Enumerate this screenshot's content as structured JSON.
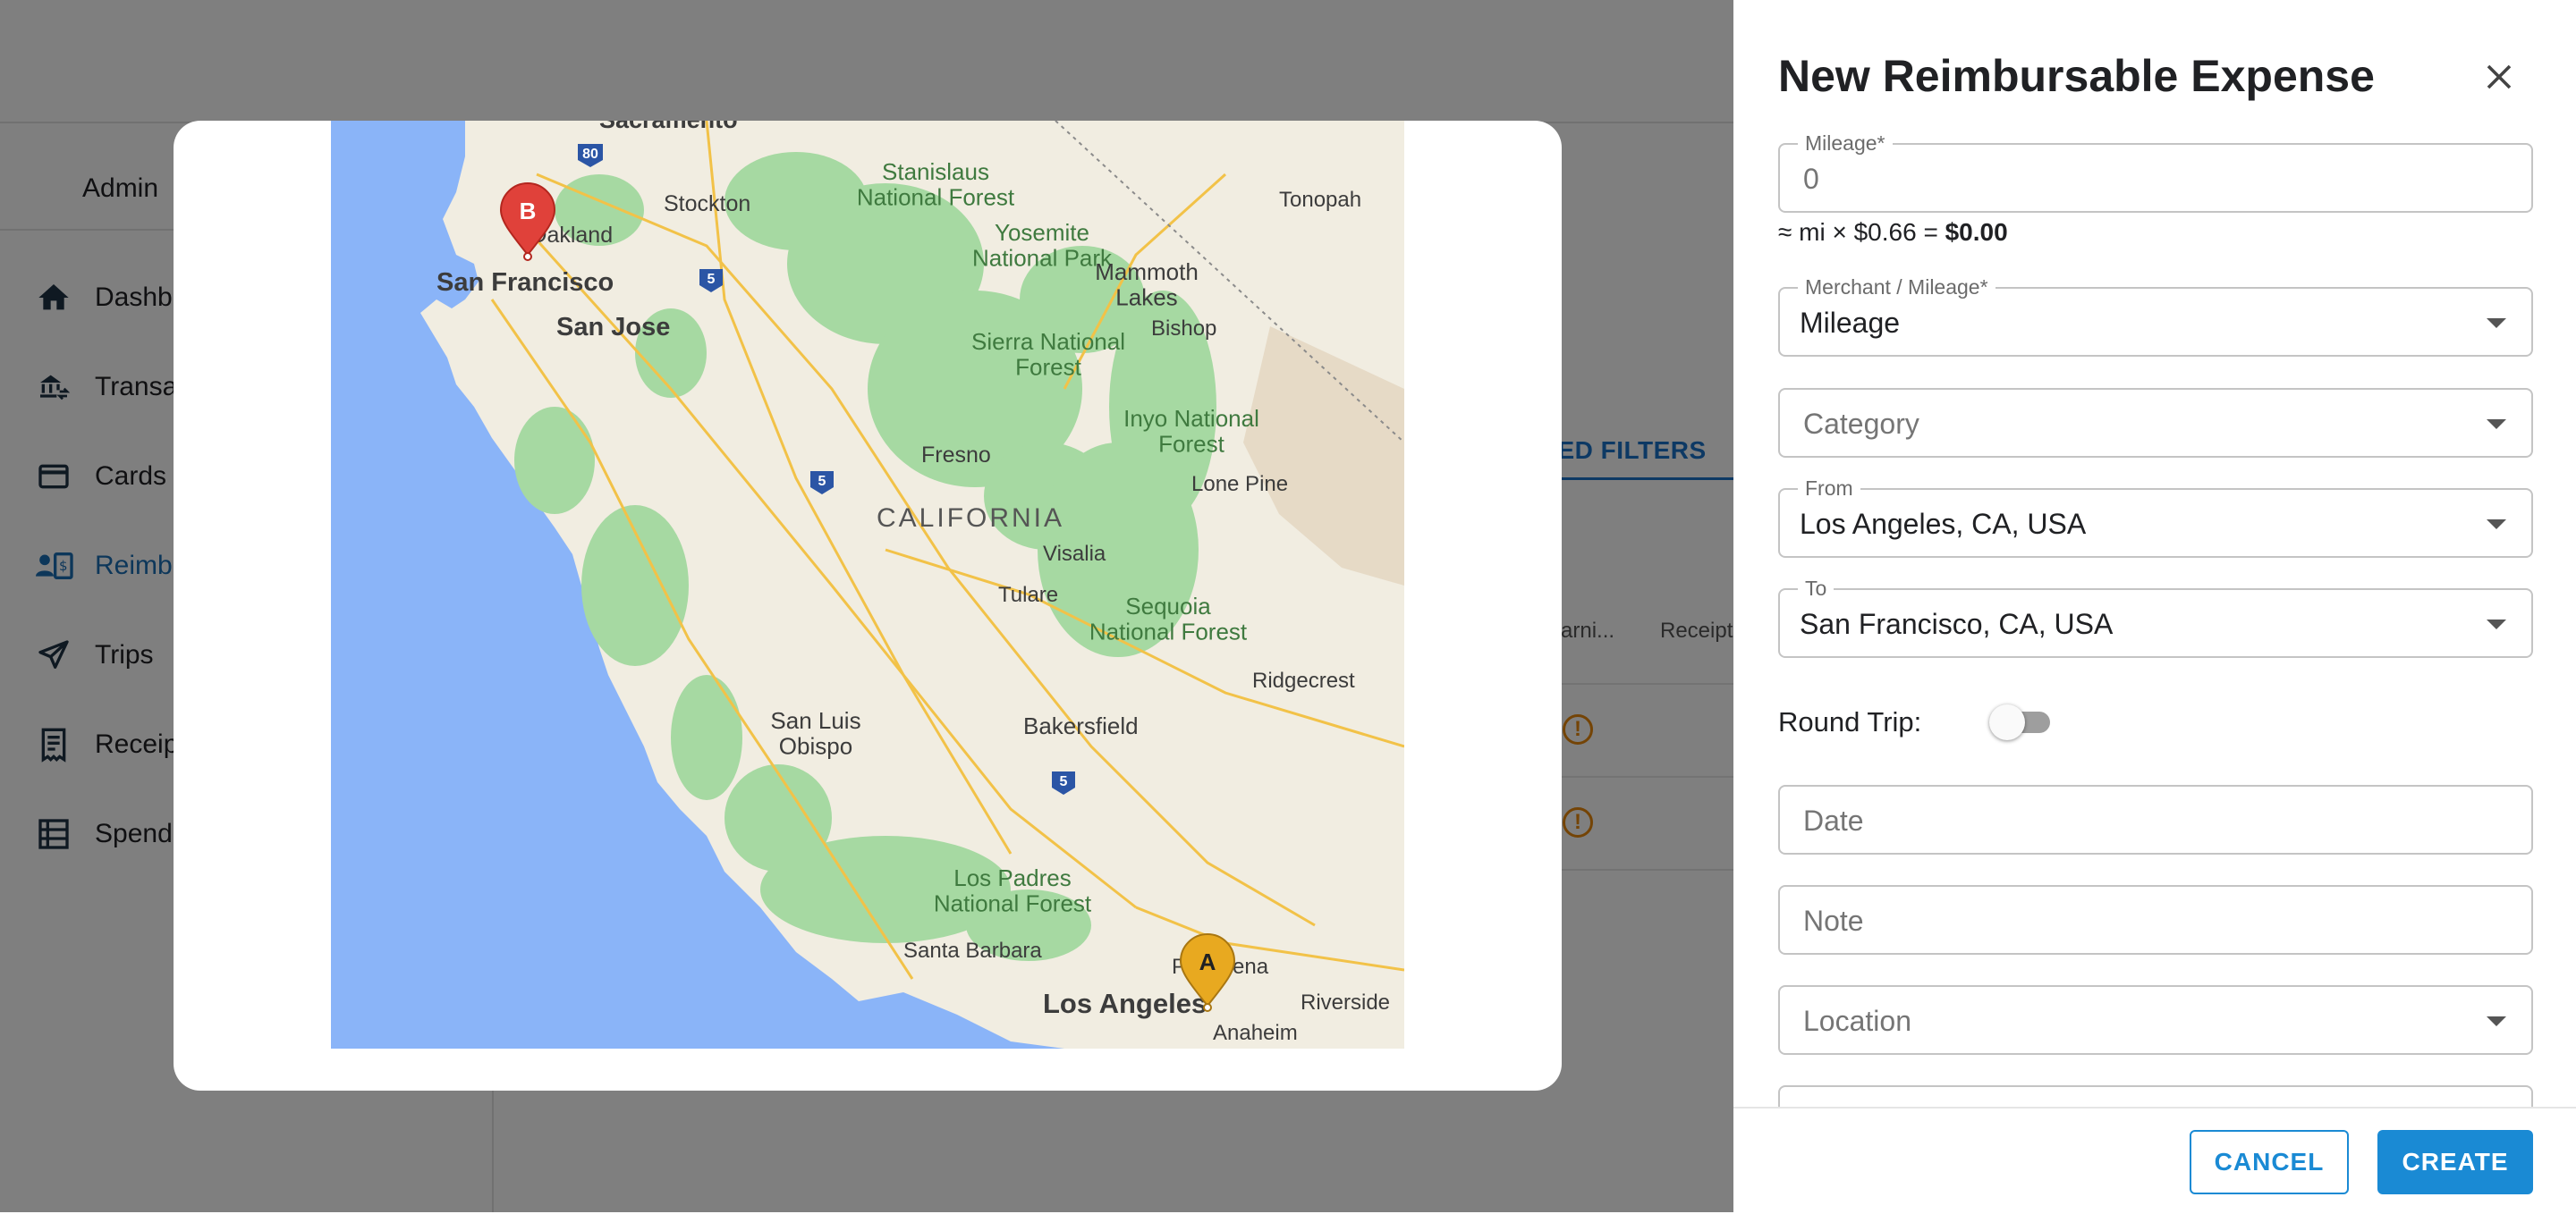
{
  "app": {
    "subnav_title": "Admin",
    "sidebar": {
      "items": [
        {
          "label": "Dashb",
          "icon": "home-icon"
        },
        {
          "label": "Transa",
          "icon": "bank-transfer-icon"
        },
        {
          "label": "Cards",
          "icon": "card-icon"
        },
        {
          "label": "Reimb",
          "icon": "reimbursement-icon",
          "active": true
        },
        {
          "label": "Trips",
          "icon": "plane-icon"
        },
        {
          "label": "Receip",
          "icon": "receipt-icon"
        },
        {
          "label": "Spend",
          "icon": "spend-list-icon"
        }
      ]
    },
    "advanced_filters_label": "NCED FILTERS",
    "table": {
      "columns": [
        "arni...",
        "Receipt"
      ],
      "warning_glyph": "!"
    }
  },
  "map": {
    "labels": {
      "sacramento": "Sacramento",
      "stockton": "Stockton",
      "oakland": "Oakland",
      "san_francisco": "San Francisco",
      "san_jose": "San Jose",
      "stanislaus": "Stanislaus\nNational Forest",
      "yosemite": "Yosemite\nNational Park",
      "mammoth": "Mammoth\nLakes",
      "tonopah": "Tonopah",
      "bishop": "Bishop",
      "sierra": "Sierra National\nForest",
      "inyo": "Inyo National\nForest",
      "fresno": "Fresno",
      "lone_pine": "Lone Pine",
      "california": "CALIFORNIA",
      "visalia": "Visalia",
      "tulare": "Tulare",
      "sequoia": "Sequoia\nNational Forest",
      "ridgecrest": "Ridgecrest",
      "san_luis_obispo": "San Luis\nObispo",
      "bakersfield": "Bakersfield",
      "los_padres": "Los Padres\nNational Forest",
      "santa_barbara": "Santa Barbara",
      "pasadena": "Pasadena",
      "los_angeles": "Los Angeles",
      "riverside": "Riverside",
      "anaheim": "Anaheim"
    },
    "highways": [
      "80",
      "5",
      "5",
      "5"
    ],
    "markers": {
      "origin": {
        "letter": "A",
        "color": "#e8a920"
      },
      "destination": {
        "letter": "B",
        "color": "#e0413a"
      }
    }
  },
  "drawer": {
    "title": "New Reimbursable Expense",
    "close_icon": "close-icon",
    "mileage": {
      "label": "Mileage",
      "required_mark": "*",
      "placeholder": "0"
    },
    "calc": {
      "prefix": "≈ mi × $0.66 = ",
      "total": "$0.00"
    },
    "merchant": {
      "label": "Merchant / Mileage",
      "required_mark": "*",
      "value": "Mileage"
    },
    "category": {
      "placeholder": "Category"
    },
    "from": {
      "label": "From",
      "value": "Los Angeles, CA, USA"
    },
    "to": {
      "label": "To",
      "value": "San Francisco, CA, USA"
    },
    "round_trip": {
      "label": "Round Trip:",
      "enabled": false
    },
    "date": {
      "placeholder": "Date"
    },
    "note": {
      "placeholder": "Note"
    },
    "location": {
      "placeholder": "Location"
    },
    "footer": {
      "cancel_label": "CANCEL",
      "create_label": "CREATE"
    }
  },
  "colors": {
    "accent": "#1a8ad4",
    "active_nav": "#1b6eb5",
    "warning": "#e8890c",
    "map_water": "#8ab4f8",
    "map_land": "#f1ede1",
    "map_forest": "#a6d9a2"
  }
}
